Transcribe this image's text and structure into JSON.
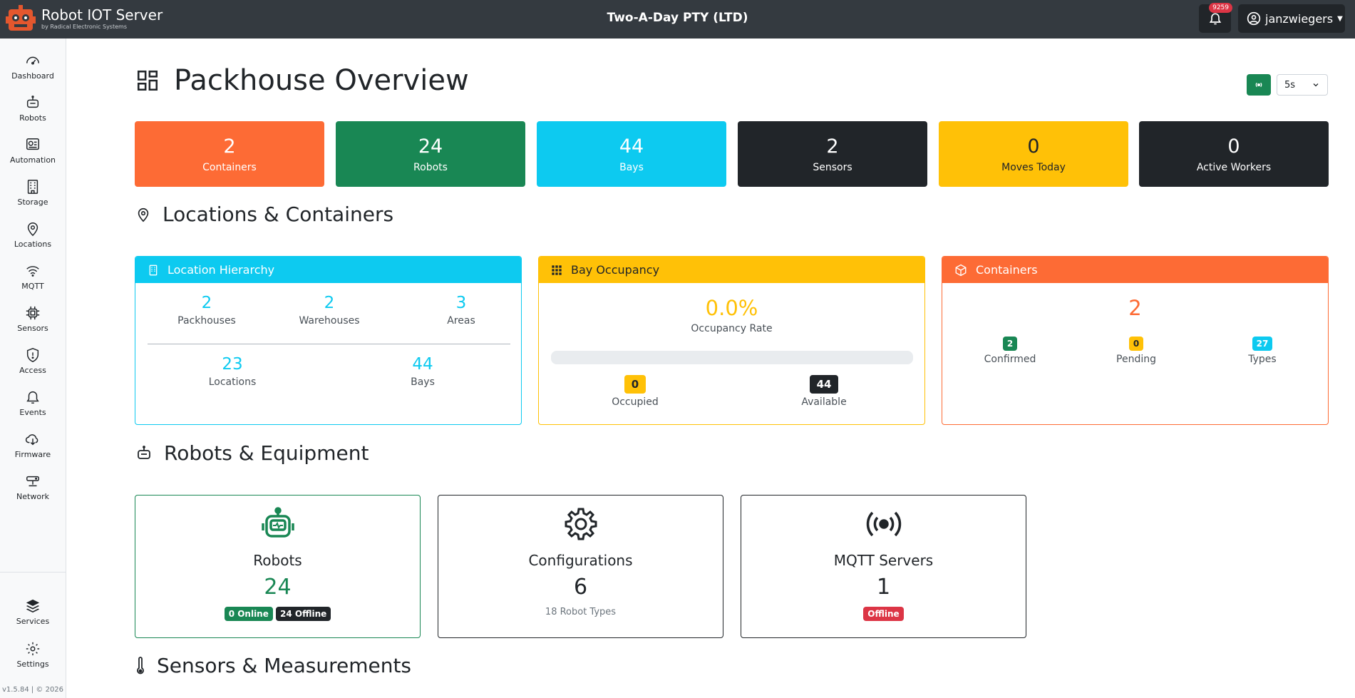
{
  "app": {
    "title": "Robot IOT Server",
    "subtitle": "by Radical Electronic Systems",
    "company": "Two-A-Day PTY (LTD)"
  },
  "header": {
    "notification_count": "9259",
    "username": "janzwiegers"
  },
  "sidebar": {
    "items": [
      {
        "label": "Dashboard",
        "icon": "speedometer-icon"
      },
      {
        "label": "Robots",
        "icon": "robot-icon"
      },
      {
        "label": "Automation",
        "icon": "automation-icon"
      },
      {
        "label": "Storage",
        "icon": "building-icon"
      },
      {
        "label": "Locations",
        "icon": "pin-icon"
      },
      {
        "label": "MQTT",
        "icon": "wifi-icon"
      },
      {
        "label": "Sensors",
        "icon": "cpu-icon"
      },
      {
        "label": "Access",
        "icon": "shield-icon"
      },
      {
        "label": "Events",
        "icon": "bell-icon"
      },
      {
        "label": "Firmware",
        "icon": "cloud-download-icon"
      },
      {
        "label": "Network",
        "icon": "router-icon"
      }
    ],
    "bottom": [
      {
        "label": "Services",
        "icon": "layers-icon"
      },
      {
        "label": "Settings",
        "icon": "gear-icon"
      }
    ],
    "version": "v1.5.84 | © 2026"
  },
  "page": {
    "title": "Packhouse Overview",
    "refresh_interval": "5s"
  },
  "stats": [
    {
      "value": "2",
      "label": "Containers",
      "color": "#fd6b35"
    },
    {
      "value": "24",
      "label": "Robots",
      "color": "#198754"
    },
    {
      "value": "44",
      "label": "Bays",
      "color": "#0dcaf0"
    },
    {
      "value": "2",
      "label": "Sensors",
      "color": "#212529"
    },
    {
      "value": "0",
      "label": "Moves Today",
      "color": "#ffc107"
    },
    {
      "value": "0",
      "label": "Active Workers",
      "color": "#212529"
    }
  ],
  "sections": {
    "locations": "Locations & Containers",
    "robots": "Robots & Equipment",
    "sensors": "Sensors & Measurements"
  },
  "location_hierarchy": {
    "title": "Location Hierarchy",
    "packhouses": {
      "value": "2",
      "label": "Packhouses"
    },
    "warehouses": {
      "value": "2",
      "label": "Warehouses"
    },
    "areas": {
      "value": "3",
      "label": "Areas"
    },
    "locations": {
      "value": "23",
      "label": "Locations"
    },
    "bays": {
      "value": "44",
      "label": "Bays"
    }
  },
  "bay_occupancy": {
    "title": "Bay Occupancy",
    "rate": "0.0%",
    "rate_label": "Occupancy Rate",
    "occupied": {
      "value": "0",
      "label": "Occupied"
    },
    "available": {
      "value": "44",
      "label": "Available"
    }
  },
  "containers": {
    "title": "Containers",
    "total": "2",
    "confirmed": {
      "value": "2",
      "label": "Confirmed"
    },
    "pending": {
      "value": "0",
      "label": "Pending"
    },
    "types": {
      "value": "27",
      "label": "Types"
    }
  },
  "equipment": {
    "robots": {
      "title": "Robots",
      "value": "24",
      "online": "0 Online",
      "offline": "24 Offline"
    },
    "configurations": {
      "title": "Configurations",
      "value": "6",
      "sub": "18 Robot Types"
    },
    "mqtt": {
      "title": "MQTT Servers",
      "value": "1",
      "status": "Offline"
    }
  },
  "colors": {
    "accent_orange": "#fd6b35",
    "success": "#198754",
    "info": "#0dcaf0",
    "warning": "#ffc107",
    "dark": "#212529",
    "danger": "#dc3545"
  }
}
